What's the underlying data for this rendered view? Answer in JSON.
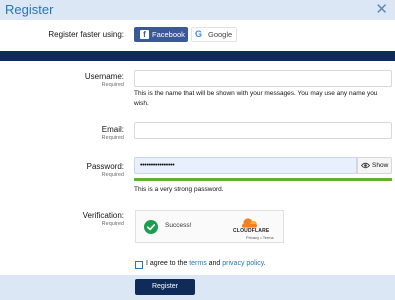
{
  "header": {
    "title": "Register",
    "close_icon": "close-icon"
  },
  "social": {
    "label": "Register faster using:",
    "facebook": "Facebook",
    "google": "Google",
    "facebook_color": "#3b5998"
  },
  "form": {
    "required_text": "Required",
    "username": {
      "label": "Username:",
      "value": "",
      "hint": "This is the name that will be shown with your messages. You may use any name you wish."
    },
    "email": {
      "label": "Email:",
      "value": ""
    },
    "password": {
      "label": "Password:",
      "value": "••••••••••••••••",
      "show_label": "Show",
      "strength_text": "This is a very strong password.",
      "strength_fraction": 1.0,
      "strength_color": "#63b035"
    },
    "verification": {
      "label": "Verification:",
      "status": "Success!",
      "provider": "CLOUDFLARE",
      "privacy": "Privacy",
      "separator": " • ",
      "terms": "Terms"
    },
    "agree": {
      "prefix": "I agree to the ",
      "terms": "terms",
      "middle": " and ",
      "privacy": "privacy policy",
      "suffix": ".",
      "checked": false
    }
  },
  "footer": {
    "register_label": "Register"
  },
  "colors": {
    "accent": "#2577b1",
    "navy": "#0f2b59",
    "header_bg": "#dce7f5"
  }
}
